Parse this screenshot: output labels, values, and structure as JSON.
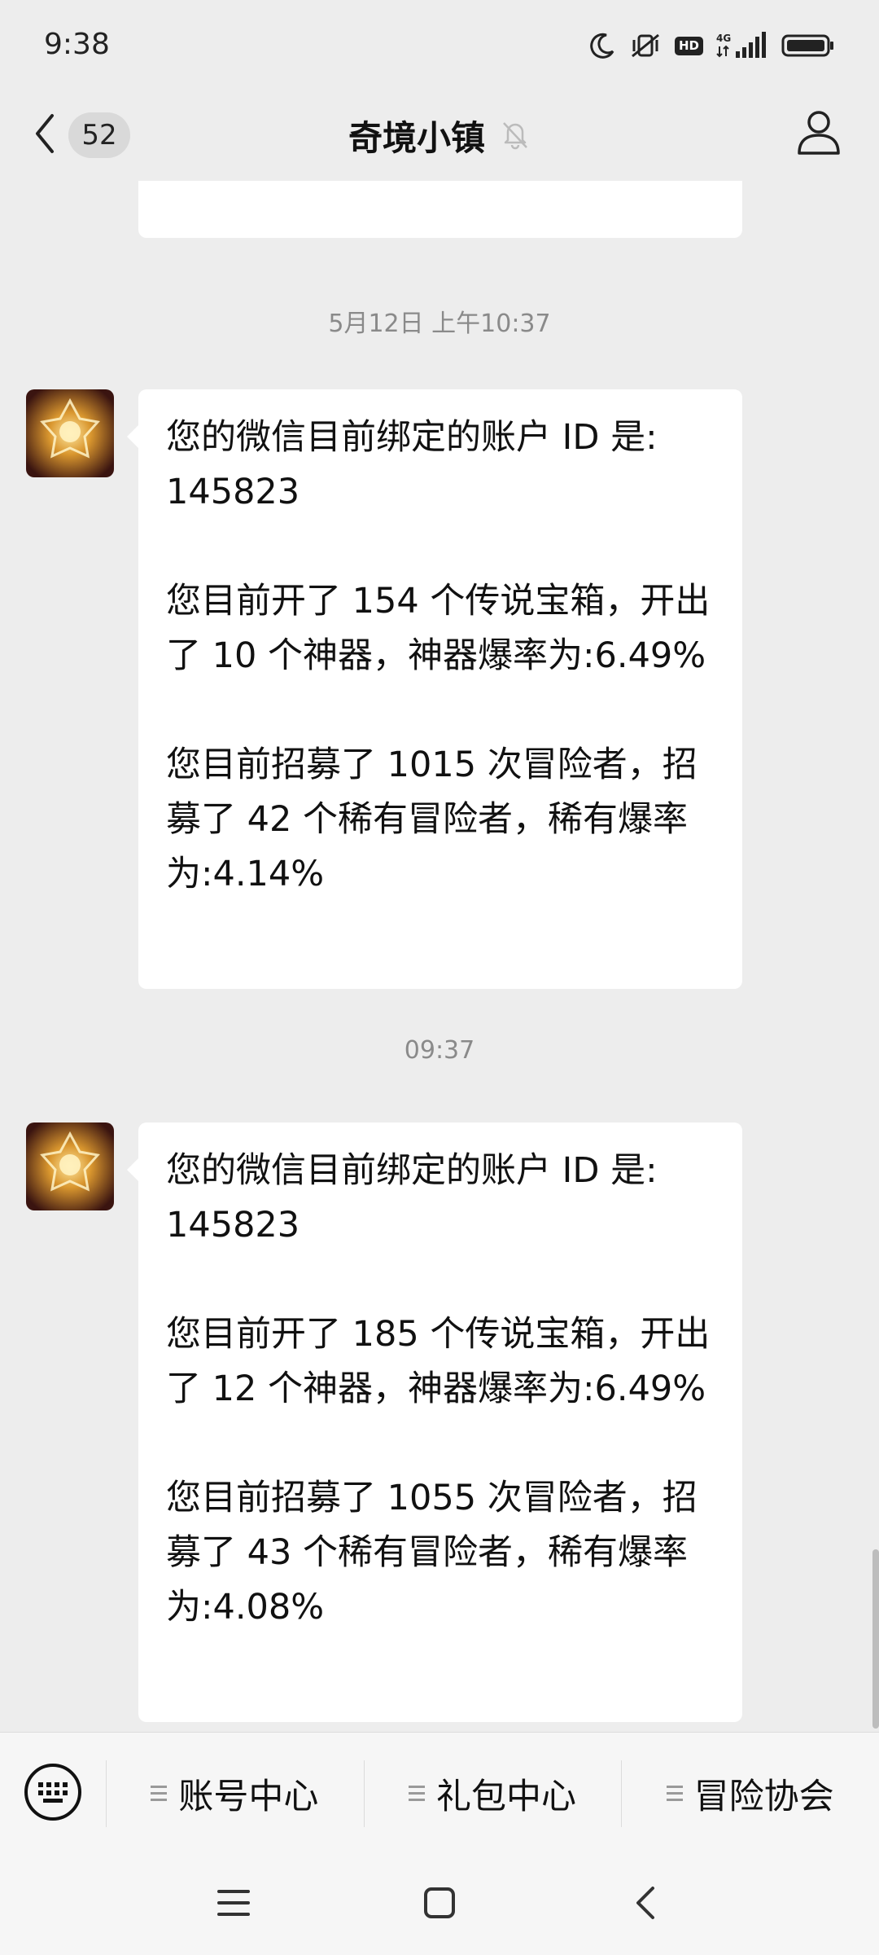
{
  "status_bar": {
    "time": "9:38",
    "network": "4G",
    "hd_label": "HD",
    "icons": [
      "moon-icon",
      "mute-vibrate-icon",
      "hd-icon",
      "signal-4g-icon",
      "battery-icon"
    ]
  },
  "header": {
    "unread_count": "52",
    "title": "奇境小镇",
    "icons": [
      "back-chevron-icon",
      "muted-bell-icon",
      "profile-icon"
    ]
  },
  "messages": [
    {
      "timestamp": "5月12日 上午10:37",
      "lines": [
        "您的微信目前绑定的账户 ID 是:",
        "145823",
        "",
        "您目前开了 154 个传说宝箱，开出",
        "了 10 个神器，神器爆率为:6.49%",
        "",
        "您目前招募了 1015 次冒险者，招",
        "募了 42 个稀有冒险者，稀有爆率",
        "为:4.14%"
      ]
    },
    {
      "timestamp": "09:37",
      "lines": [
        "您的微信目前绑定的账户 ID 是:",
        "145823",
        "",
        "您目前开了 185 个传说宝箱，开出",
        "了 12 个神器，神器爆率为:6.49%",
        "",
        "您目前招募了 1055 次冒险者，招",
        "募了 43 个稀有冒险者，稀有爆率",
        "为:4.08%"
      ]
    }
  ],
  "menu": {
    "items": [
      "账号中心",
      "礼包中心",
      "冒险协会"
    ]
  },
  "colors": {
    "background": "#ededed",
    "bubble": "#ffffff",
    "timestamp": "#8a8a8a",
    "menu_bar": "#f6f6f6"
  }
}
